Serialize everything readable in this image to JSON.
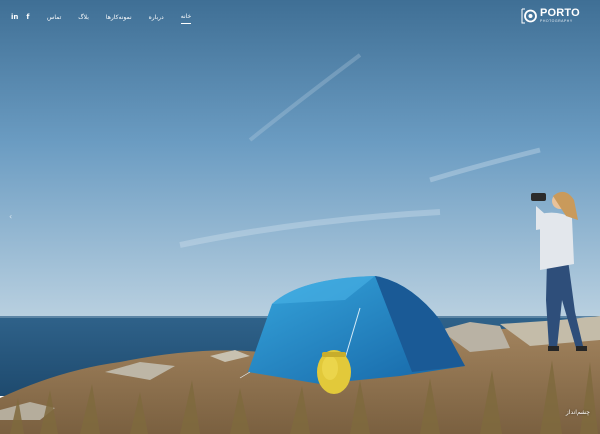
{
  "social": {
    "linkedin_glyph": "in",
    "facebook_glyph": "f"
  },
  "nav": {
    "items": [
      {
        "label": "تماس"
      },
      {
        "label": "بلاگ"
      },
      {
        "label": "نمونه‌کارها"
      },
      {
        "label": "درباره"
      },
      {
        "label": "خانه"
      }
    ],
    "active_index": 4
  },
  "logo": {
    "brand": "PORTO",
    "tagline": "PHOTOGRAPHY"
  },
  "slider": {
    "prev_arrow": "‹"
  },
  "caption": "چشم‌انداز",
  "colors": {
    "sky_top": "#4c7ba0",
    "sky_bottom": "#aec8dc",
    "sea": "#2b5a80",
    "tent": "#1f86c2",
    "ground": "#9a7b52"
  }
}
